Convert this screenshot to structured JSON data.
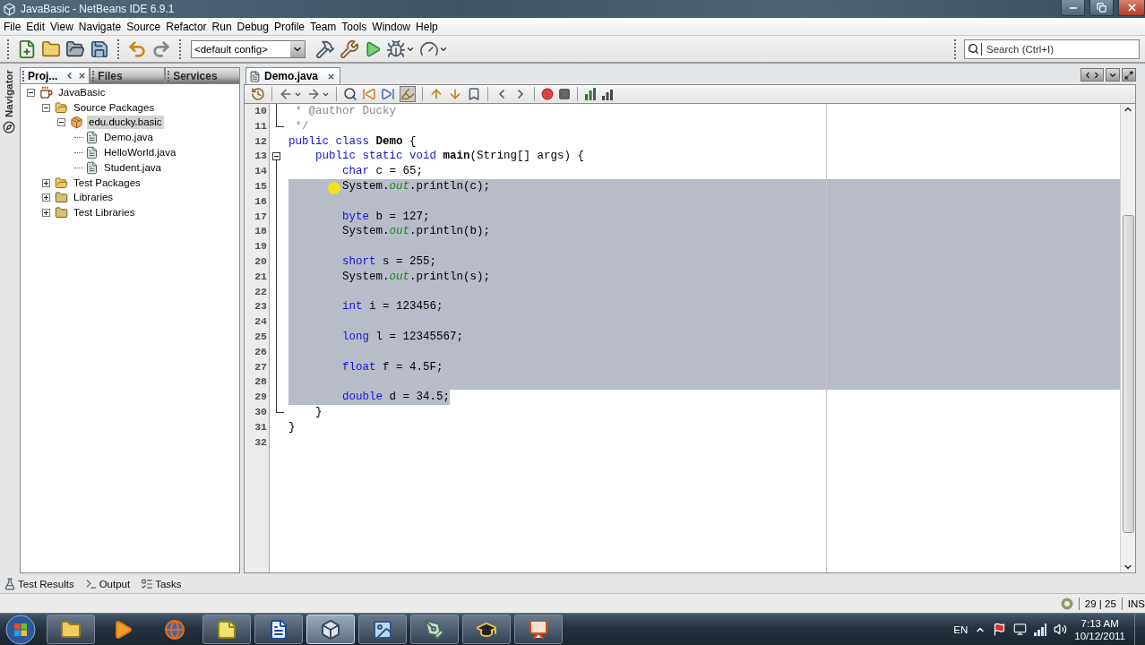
{
  "window": {
    "title": "JavaBasic - NetBeans IDE 6.9.1"
  },
  "menu": [
    "File",
    "Edit",
    "View",
    "Navigate",
    "Source",
    "Refactor",
    "Run",
    "Debug",
    "Profile",
    "Team",
    "Tools",
    "Window",
    "Help"
  ],
  "toolbar": {
    "config": "<default config>",
    "search": {
      "placeholder": "Search (Ctrl+I)"
    }
  },
  "navigator": {
    "label": "Navigator"
  },
  "projects_panel": {
    "tabs": [
      {
        "label": "Proj...",
        "selected": true
      },
      {
        "label": "Files",
        "selected": false
      },
      {
        "label": "Services",
        "selected": false
      }
    ],
    "tree": [
      {
        "label": "JavaBasic",
        "kind": "project",
        "expanded": true,
        "selected": false,
        "children": [
          {
            "label": "Source Packages",
            "kind": "source-folder",
            "expanded": true,
            "selected": false,
            "children": [
              {
                "label": "edu.ducky.basic",
                "kind": "package",
                "expanded": true,
                "selected": true,
                "children": [
                  {
                    "label": "Demo.java",
                    "kind": "file",
                    "selected": false
                  },
                  {
                    "label": "HelloWorld.java",
                    "kind": "file",
                    "selected": false
                  },
                  {
                    "label": "Student.java",
                    "kind": "file",
                    "selected": false
                  }
                ]
              }
            ]
          },
          {
            "label": "Test Packages",
            "kind": "source-folder",
            "expanded": false,
            "selected": false
          },
          {
            "label": "Libraries",
            "kind": "library",
            "expanded": false,
            "selected": false
          },
          {
            "label": "Test Libraries",
            "kind": "library",
            "expanded": false,
            "selected": false
          }
        ]
      }
    ]
  },
  "editor": {
    "tabs": [
      {
        "label": "Demo.java",
        "selected": true
      }
    ],
    "lines": [
      {
        "number": "10",
        "kind": "fold-body",
        "selected": false,
        "tokens": [
          {
            "kind": "comment",
            "text": " * @author Ducky"
          }
        ]
      },
      {
        "number": "11",
        "kind": "fold-end",
        "selected": false,
        "tokens": [
          {
            "kind": "comment",
            "text": " */"
          }
        ]
      },
      {
        "number": "12",
        "kind": "plain",
        "selected": false,
        "tokens": [
          {
            "kind": "keyword",
            "text": "public class "
          },
          {
            "kind": "bold",
            "text": "Demo"
          },
          {
            "kind": "plain",
            "text": " {"
          }
        ]
      },
      {
        "number": "13",
        "kind": "fold-start",
        "selected": false,
        "tokens": [
          {
            "kind": "keyword",
            "text": "    public static void "
          },
          {
            "kind": "bold",
            "text": "main"
          },
          {
            "kind": "plain",
            "text": "(String[] args) {"
          }
        ]
      },
      {
        "number": "14",
        "kind": "fold-body",
        "selected": false,
        "tokens": [
          {
            "kind": "keyword",
            "text": "        char"
          },
          {
            "kind": "plain",
            "text": " c = 65;"
          }
        ]
      },
      {
        "number": "15",
        "kind": "fold-body",
        "selected": true,
        "tokens": [
          {
            "kind": "plain",
            "text": "        System."
          },
          {
            "kind": "field",
            "text": "out"
          },
          {
            "kind": "plain",
            "text": ".println(c);"
          }
        ]
      },
      {
        "number": "16",
        "kind": "fold-body",
        "selected": true
      },
      {
        "number": "17",
        "kind": "fold-body",
        "selected": true,
        "tokens": [
          {
            "kind": "keyword",
            "text": "        byte"
          },
          {
            "kind": "plain",
            "text": " b = 127;"
          }
        ]
      },
      {
        "number": "18",
        "kind": "fold-body",
        "selected": true,
        "tokens": [
          {
            "kind": "plain",
            "text": "        System."
          },
          {
            "kind": "field",
            "text": "out"
          },
          {
            "kind": "plain",
            "text": ".println(b);"
          }
        ]
      },
      {
        "number": "19",
        "kind": "fold-body",
        "selected": true
      },
      {
        "number": "20",
        "kind": "fold-body",
        "selected": true,
        "tokens": [
          {
            "kind": "keyword",
            "text": "        short"
          },
          {
            "kind": "plain",
            "text": " s = 255;"
          }
        ]
      },
      {
        "number": "21",
        "kind": "fold-body",
        "selected": true,
        "tokens": [
          {
            "kind": "plain",
            "text": "        System."
          },
          {
            "kind": "field",
            "text": "out"
          },
          {
            "kind": "plain",
            "text": ".println(s);"
          }
        ]
      },
      {
        "number": "22",
        "kind": "fold-body",
        "selected": true
      },
      {
        "number": "23",
        "kind": "fold-body",
        "selected": true,
        "tokens": [
          {
            "kind": "keyword",
            "text": "        int"
          },
          {
            "kind": "plain",
            "text": " i = 123456;"
          }
        ]
      },
      {
        "number": "24",
        "kind": "fold-body",
        "selected": true
      },
      {
        "number": "25",
        "kind": "fold-body",
        "selected": true,
        "tokens": [
          {
            "kind": "keyword",
            "text": "        long"
          },
          {
            "kind": "plain",
            "text": " l = 12345567;"
          }
        ]
      },
      {
        "number": "26",
        "kind": "fold-body",
        "selected": true
      },
      {
        "number": "27",
        "kind": "fold-body",
        "selected": true,
        "tokens": [
          {
            "kind": "keyword",
            "text": "        float"
          },
          {
            "kind": "plain",
            "text": " f = 4.5F;"
          }
        ]
      },
      {
        "number": "28",
        "kind": "fold-body",
        "selected": true
      },
      {
        "number": "29",
        "kind": "fold-body",
        "selected": true,
        "tokens": [
          {
            "kind": "keyword",
            "text": "        double"
          },
          {
            "kind": "plain",
            "text": " d = 34.5;"
          }
        ]
      },
      {
        "number": "30",
        "kind": "fold-end",
        "selected": false,
        "tokens": [
          {
            "kind": "plain",
            "text": "    }"
          }
        ]
      },
      {
        "number": "31",
        "kind": "plain",
        "selected": false,
        "tokens": [
          {
            "kind": "plain",
            "text": "}"
          }
        ]
      },
      {
        "number": "32",
        "kind": "plain",
        "selected": false
      }
    ]
  },
  "output_tabs": [
    {
      "label": "Test Results",
      "kind": "tests"
    },
    {
      "label": "Output",
      "kind": "output"
    },
    {
      "label": "Tasks",
      "kind": "tasks"
    }
  ],
  "status_bar": {
    "position": "29 | 25",
    "mode": "INS"
  },
  "taskbar": {
    "apps": [
      {
        "kind": "folder",
        "running": true,
        "selected": false
      },
      {
        "kind": "media",
        "running": false,
        "selected": false
      },
      {
        "kind": "browser",
        "running": false,
        "selected": false
      },
      {
        "kind": "notes",
        "running": true,
        "selected": false
      },
      {
        "kind": "document",
        "running": true,
        "selected": false
      },
      {
        "kind": "cube",
        "running": true,
        "selected": true
      },
      {
        "kind": "picture",
        "running": true,
        "selected": false
      },
      {
        "kind": "pen",
        "running": true,
        "selected": false
      },
      {
        "kind": "hat",
        "running": true,
        "selected": false
      },
      {
        "kind": "presentation",
        "running": true,
        "selected": false
      }
    ],
    "language": "EN",
    "time": "7:13 AM",
    "date": "10/12/2011"
  }
}
